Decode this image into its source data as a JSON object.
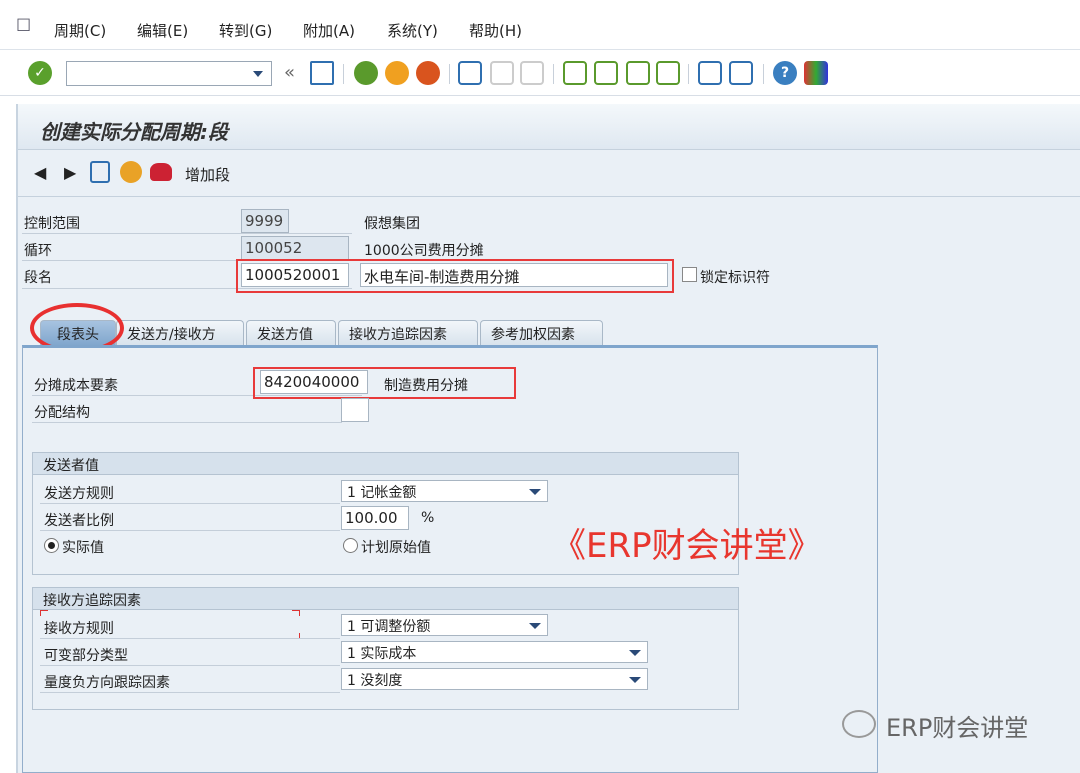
{
  "menu": [
    "周期(C)",
    "编辑(E)",
    "转到(G)",
    "附加(A)",
    "系统(Y)",
    "帮助(H)"
  ],
  "title": "创建实际分配周期:段",
  "app_toolbar": {
    "add_segment": "增加段"
  },
  "header": {
    "controlling_area_label": "控制范围",
    "controlling_area": "9999",
    "controlling_area_name": "假想集团",
    "cycle_label": "循环",
    "cycle": "100052",
    "cycle_name": "1000公司费用分摊",
    "segment_label": "段名",
    "segment": "1000520001",
    "segment_name": "水电车间-制造费用分摊",
    "lock_label": "锁定标识符"
  },
  "tabs": [
    "段表头",
    "发送方/接收方",
    "发送方值",
    "接收方追踪因素",
    "参考加权因素"
  ],
  "segment_header": {
    "cost_element_label": "分摊成本要素",
    "cost_element": "8420040000",
    "cost_element_name": "制造费用分摊",
    "alloc_structure_label": "分配结构"
  },
  "sender_values": {
    "title": "发送者值",
    "rule_label": "发送方规则",
    "rule": "1 记帐金额",
    "share_label": "发送者比例",
    "share": "100.00",
    "share_unit": "%",
    "actual_label": "实际值",
    "plan_label": "计划原始值"
  },
  "receiver_tracing": {
    "title": "接收方追踪因素",
    "rule_label": "接收方规则",
    "rule": "1 可调整份额",
    "var_type_label": "可变部分类型",
    "var_type": "1 实际成本",
    "neg_label": "量度负方向跟踪因素",
    "neg": "1 没刻度"
  },
  "watermark": "《ERP财会讲堂》",
  "footer_brand": "ERP财会讲堂"
}
